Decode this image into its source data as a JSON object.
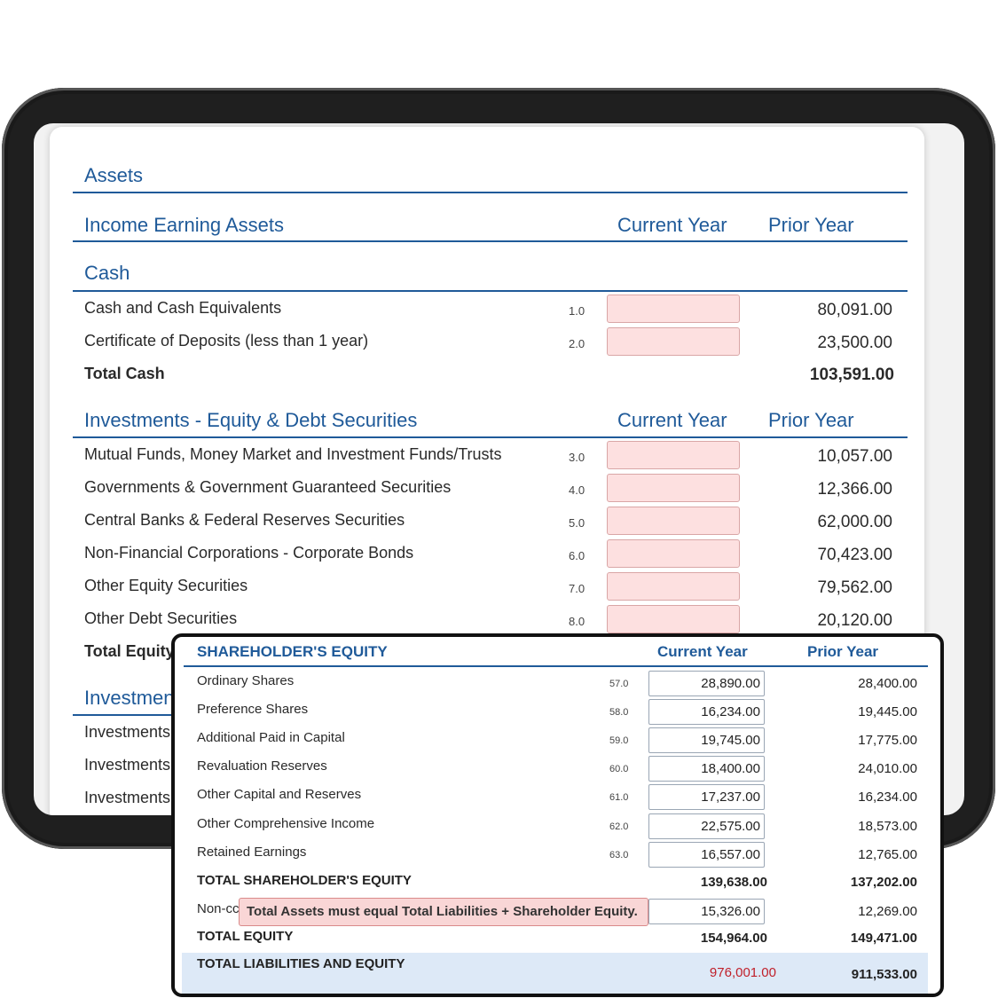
{
  "sheet": {
    "title": "Assets",
    "income_earning_assets": "Income Earning Assets",
    "col_current": "Current Year",
    "col_prior": "Prior Year",
    "cash": {
      "title": "Cash",
      "rows": [
        {
          "label": "Cash and Cash Equivalents",
          "ref": "1.0",
          "prior": "80,091.00"
        },
        {
          "label": "Certificate of Deposits (less than 1 year)",
          "ref": "2.0",
          "prior": "23,500.00"
        }
      ],
      "total_label": "Total Cash",
      "total_prior": "103,591.00"
    },
    "investments": {
      "title": "Investments - Equity & Debt Securities",
      "rows": [
        {
          "label": "Mutual Funds, Money Market and Investment Funds/Trusts",
          "ref": "3.0",
          "prior": "10,057.00"
        },
        {
          "label": "Governments & Government Guaranteed Securities",
          "ref": "4.0",
          "prior": "12,366.00"
        },
        {
          "label": "Central Banks & Federal Reserves Securities",
          "ref": "5.0",
          "prior": "62,000.00"
        },
        {
          "label": "Non-Financial Corporations - Corporate Bonds",
          "ref": "6.0",
          "prior": "70,423.00"
        },
        {
          "label": "Other Equity Securities",
          "ref": "7.0",
          "prior": "79,562.00"
        },
        {
          "label": "Other Debt Securities",
          "ref": "8.0",
          "prior": "20,120.00"
        }
      ],
      "total_label_partial": "Total Equity"
    },
    "next_section_partial": "Investmen",
    "next_rows_partial": [
      "Investments",
      "Investments",
      "Investments"
    ]
  },
  "equity_card": {
    "title": "SHAREHOLDER'S EQUITY",
    "col_current": "Current Year",
    "col_prior": "Prior Year",
    "rows": [
      {
        "label": "Ordinary Shares",
        "ref": "57.0",
        "current": "28,890.00",
        "prior": "28,400.00"
      },
      {
        "label": "Preference Shares",
        "ref": "58.0",
        "current": "16,234.00",
        "prior": "19,445.00"
      },
      {
        "label": "Additional Paid in Capital",
        "ref": "59.0",
        "current": "19,745.00",
        "prior": "17,775.00"
      },
      {
        "label": "Revaluation Reserves",
        "ref": "60.0",
        "current": "18,400.00",
        "prior": "24,010.00"
      },
      {
        "label": "Other Capital and Reserves",
        "ref": "61.0",
        "current": "17,237.00",
        "prior": "16,234.00"
      },
      {
        "label": "Other Comprehensive Income",
        "ref": "62.0",
        "current": "22,575.00",
        "prior": "18,573.00"
      },
      {
        "label": "Retained Earnings",
        "ref": "63.0",
        "current": "16,557.00",
        "prior": "12,765.00"
      }
    ],
    "total_shareholder_label": "TOTAL SHAREHOLDER'S EQUITY",
    "total_shareholder_current": "139,638.00",
    "total_shareholder_prior": "137,202.00",
    "noncontrolling_partial_label": "Non-cc",
    "noncontrolling_current": "15,326.00",
    "noncontrolling_prior": "12,269.00",
    "error_message": "Total Assets must equal Total Liabilities + Shareholder Equity.",
    "total_equity_label": "TOTAL EQUITY",
    "total_equity_current": "154,964.00",
    "total_equity_prior": "149,471.00",
    "total_liab_label": "TOTAL LIABILITIES AND EQUITY",
    "total_liab_current": "976,001.00",
    "total_liab_prior": "911,533.00"
  },
  "colors": {
    "accent_blue": "#1f5a99",
    "input_error_bg": "#fde0e0",
    "error_text": "#c0202a",
    "total_band": "#dde9f7"
  }
}
